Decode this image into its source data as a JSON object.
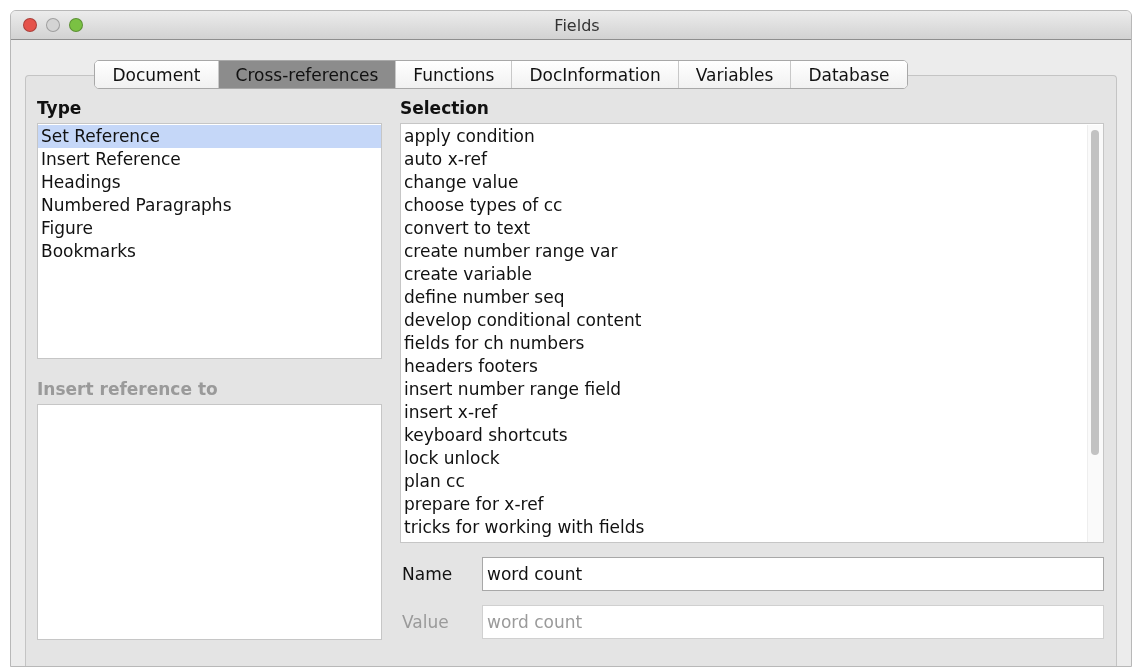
{
  "window": {
    "title": "Fields"
  },
  "tabs": [
    {
      "label": "Document",
      "selected": false
    },
    {
      "label": "Cross-references",
      "selected": true
    },
    {
      "label": "Functions",
      "selected": false
    },
    {
      "label": "DocInformation",
      "selected": false
    },
    {
      "label": "Variables",
      "selected": false
    },
    {
      "label": "Database",
      "selected": false
    }
  ],
  "type": {
    "label": "Type",
    "items": [
      {
        "label": "Set Reference",
        "selected": true
      },
      {
        "label": "Insert Reference",
        "selected": false
      },
      {
        "label": "Headings",
        "selected": false
      },
      {
        "label": "Numbered Paragraphs",
        "selected": false
      },
      {
        "label": "Figure",
        "selected": false
      },
      {
        "label": "Bookmarks",
        "selected": false
      }
    ]
  },
  "insert_reference_to": {
    "label": "Insert reference to",
    "disabled": true
  },
  "selection": {
    "label": "Selection",
    "items": [
      {
        "label": "apply condition",
        "selected": false
      },
      {
        "label": "auto x-ref",
        "selected": false
      },
      {
        "label": "change value",
        "selected": false
      },
      {
        "label": "choose types of cc",
        "selected": false
      },
      {
        "label": "convert to text",
        "selected": false
      },
      {
        "label": "create number range var",
        "selected": false
      },
      {
        "label": "create variable",
        "selected": false
      },
      {
        "label": "define number seq",
        "selected": false
      },
      {
        "label": "develop conditional content",
        "selected": false
      },
      {
        "label": "fields for ch numbers",
        "selected": false
      },
      {
        "label": "headers footers",
        "selected": false
      },
      {
        "label": "insert number range field",
        "selected": false
      },
      {
        "label": "insert x-ref",
        "selected": false
      },
      {
        "label": "keyboard shortcuts",
        "selected": false
      },
      {
        "label": "lock unlock",
        "selected": false
      },
      {
        "label": "plan cc",
        "selected": false
      },
      {
        "label": "prepare for x-ref",
        "selected": false
      },
      {
        "label": "tricks for working with fields",
        "selected": false
      }
    ]
  },
  "name": {
    "label": "Name",
    "value": "word count",
    "disabled": false
  },
  "value": {
    "label": "Value",
    "value": "word count",
    "disabled": true
  }
}
